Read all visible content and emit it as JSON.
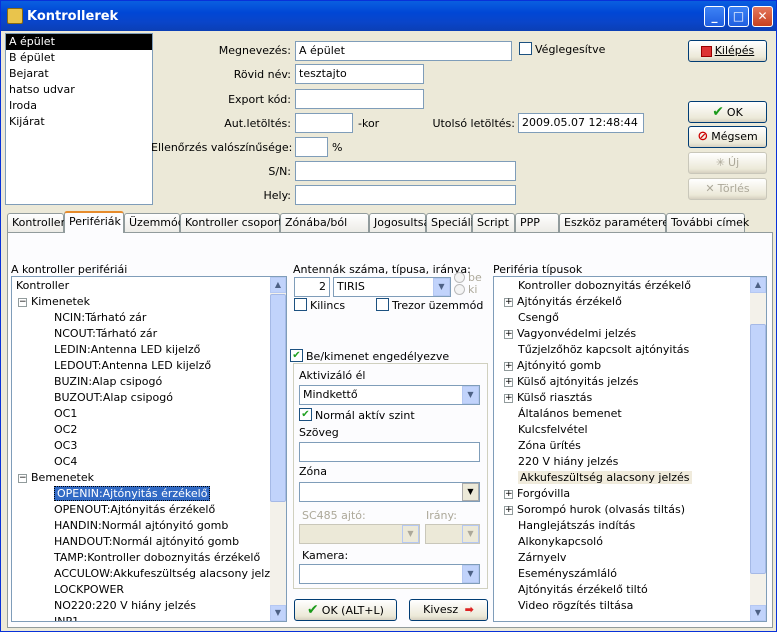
{
  "window": {
    "title": "Kontrollerek"
  },
  "buildings": [
    "A épület",
    "B épület",
    "Bejarat",
    "hatso udvar",
    "Iroda",
    "Kijárat"
  ],
  "form": {
    "name_label": "Megnevezés:",
    "name_value": "A épület",
    "final_label": "Véglegesítve",
    "short_label": "Rövid név:",
    "short_value": "tesztajto",
    "export_label": "Export kód:",
    "auto_label": "Aut.letöltés:",
    "auto_unit": "-kor",
    "last_label": "Utolsó letöltés:",
    "last_value": "2009.05.07 12:48:44",
    "check_label": "Ellenőrzés valószínűsége:",
    "check_unit": "%",
    "sn_label": "S/N:",
    "place_label": "Hely:"
  },
  "buttons": {
    "exit": "Kilépés",
    "ok": "OK",
    "cancel": "Mégsem",
    "new": "Új",
    "delete": "Törlés"
  },
  "tabs": [
    "Kontroller",
    "Perifériák",
    "Üzemmód",
    "Kontroller csoport",
    "Zónába/ból",
    "Jogosultságok",
    "Speciális",
    "Script",
    "PPP",
    "Eszköz paraméterek",
    "További címek"
  ],
  "left": {
    "title": "A kontroller perifériái",
    "root": "Kontroller",
    "outputs_label": "Kimenetek",
    "outputs": [
      "NCIN:Tárható zár",
      "NCOUT:Tárható zár",
      "LEDIN:Antenna LED kijelző",
      "LEDOUT:Antenna LED kijelző",
      "BUZIN:Alap csipogó",
      "BUZOUT:Alap csipogó",
      "OC1",
      "OC2",
      "OC3",
      "OC4"
    ],
    "inputs_label": "Bemenetek",
    "inputs": [
      "OPENIN:Ajtónyitás érzékelő",
      "OPENOUT:Ajtónyitás érzékelő",
      "HANDIN:Normál ajtónyitó gomb",
      "HANDOUT:Normál ajtónyitó gomb",
      "TAMP:Kontroller doboznyitás érzékelő",
      "ACCULOW:Akkufeszültség alacsony jelzés",
      "LOCKPOWER",
      "NO220:220 V hiány jelzés",
      "INP1"
    ]
  },
  "middle": {
    "antenna_label": "Antennák száma, típusa, iránya:",
    "antenna_count": "2",
    "antenna_type": "TIRIS",
    "dir_in": "be",
    "dir_out": "ki",
    "kilincs": "Kilincs",
    "tresor": "Trezor üzemmód",
    "enable": "Be/kimenet engedélyezve",
    "active_edge_label": "Aktivizáló él",
    "active_edge_value": "Mindkettő",
    "normal_active": "Normál aktív szint",
    "text_label": "Szöveg",
    "zone_label": "Zóna",
    "sc485_label": "SC485 ajtó:",
    "dir_label": "Irány:",
    "camera_label": "Kamera:",
    "ok_button": "OK (ALT+L)",
    "out_button": "Kivesz"
  },
  "right": {
    "title": "Periféria típusok",
    "items": [
      {
        "label": "Kontroller doboznyitás érzékelő",
        "exp": false
      },
      {
        "label": "Ajtónyitás érzékelő",
        "exp": true
      },
      {
        "label": "Csengő",
        "exp": false
      },
      {
        "label": "Vagyonvédelmi jelzés",
        "exp": true
      },
      {
        "label": "Tűzjelzőhöz kapcsolt ajtónyitás",
        "exp": false
      },
      {
        "label": "Ajtónyitó gomb",
        "exp": true
      },
      {
        "label": "Külső ajtónyitás jelzés",
        "exp": true
      },
      {
        "label": "Külső riasztás",
        "exp": true
      },
      {
        "label": "Általános bemenet",
        "exp": false
      },
      {
        "label": "Kulcsfelvétel",
        "exp": false
      },
      {
        "label": "Zóna ürítés",
        "exp": false
      },
      {
        "label": "220 V hiány jelzés",
        "exp": false
      },
      {
        "label": "Akkufeszültség alacsony jelzés",
        "exp": false
      },
      {
        "label": "Forgóvilla",
        "exp": true
      },
      {
        "label": "Sorompó hurok (olvasás tiltás)",
        "exp": true
      },
      {
        "label": "Hanglejátszás indítás",
        "exp": false
      },
      {
        "label": "Alkonykapcsoló",
        "exp": false
      },
      {
        "label": "Zárnyelv",
        "exp": false
      },
      {
        "label": "Eseményszámláló",
        "exp": false
      },
      {
        "label": "Ajtónyitás érzékelő tiltó",
        "exp": false
      },
      {
        "label": "Video rögzítés tiltása",
        "exp": false
      }
    ]
  }
}
